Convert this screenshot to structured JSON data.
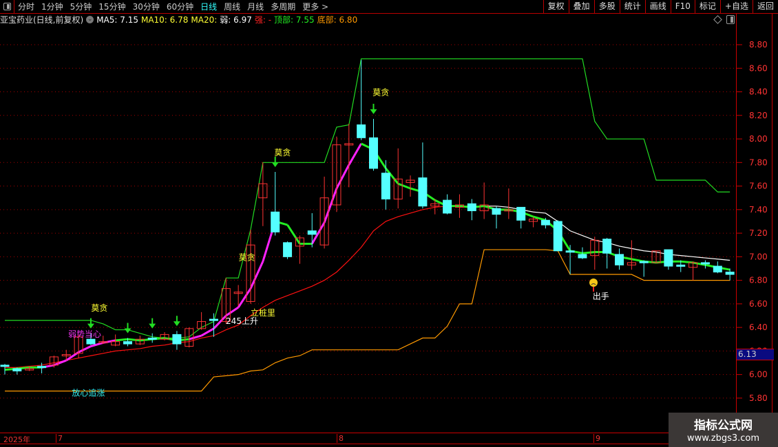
{
  "toolbar": {
    "tabs": [
      "分时",
      "1分钟",
      "5分钟",
      "15分钟",
      "30分钟",
      "60分钟",
      "日线",
      "周线",
      "月线",
      "多周期",
      "更多 >"
    ],
    "active_tab": "日线",
    "right_buttons": [
      "复权",
      "叠加",
      "多股",
      "统计",
      "画线",
      "F10",
      "标记",
      "+自选",
      "返回"
    ]
  },
  "info": {
    "title": "亚宝药业(日线,前复权)",
    "ma5": "MA5: 7.15",
    "ma10": "MA10: 6.78",
    "ma20": "MA20:",
    "weak": "弱: 6.97",
    "strong": "强: -",
    "top": "顶部: 7.55",
    "bottom": "底部: 6.80"
  },
  "price_tag": "6.13",
  "x_axis": {
    "year": "2025年",
    "months": [
      "7",
      "8",
      "9"
    ]
  },
  "watermark": {
    "line1": "指标公式网",
    "line2": "www.zbgs3.com"
  },
  "colors": {
    "up": "#ff3333",
    "down": "#54ffff",
    "top_line": "#22dd22",
    "bottom_line": "#ff9900",
    "ma20": "#ff1111",
    "weak_line": "#ffffff",
    "trend_up": "#ff22ff",
    "trend_flat": "#22ee22",
    "grid": "#aa0000",
    "axis_text": "#ff3333"
  },
  "chart_data": {
    "type": "candlestick",
    "title": "亚宝药业(日线,前复权)",
    "ylim": [
      5.7,
      8.95
    ],
    "y_ticks": [
      "8.80",
      "8.60",
      "8.40",
      "8.20",
      "8.00",
      "7.80",
      "7.60",
      "7.40",
      "7.20",
      "7.00",
      "6.80",
      "6.60",
      "6.40",
      "6.20",
      "6.00",
      "5.80"
    ],
    "candles": [
      [
        6.08,
        6.09,
        6.0,
        6.07
      ],
      [
        6.05,
        6.06,
        6.0,
        6.03
      ],
      [
        6.04,
        6.07,
        6.03,
        6.05
      ],
      [
        6.07,
        6.1,
        6.01,
        6.06
      ],
      [
        6.08,
        6.16,
        6.06,
        6.15
      ],
      [
        6.16,
        6.21,
        6.12,
        6.17
      ],
      [
        6.18,
        6.34,
        6.14,
        6.32
      ],
      [
        6.3,
        6.35,
        6.25,
        6.26
      ],
      [
        6.27,
        6.33,
        6.26,
        6.28
      ],
      [
        6.25,
        6.34,
        6.24,
        6.28
      ],
      [
        6.28,
        6.31,
        6.24,
        6.26
      ],
      [
        6.26,
        6.33,
        6.25,
        6.3
      ],
      [
        6.31,
        6.35,
        6.27,
        6.3
      ],
      [
        6.3,
        6.36,
        6.29,
        6.34
      ],
      [
        6.34,
        6.37,
        6.21,
        6.26
      ],
      [
        6.24,
        6.4,
        6.23,
        6.39
      ],
      [
        6.39,
        6.53,
        6.38,
        6.45
      ],
      [
        6.47,
        6.52,
        6.32,
        6.46
      ],
      [
        6.45,
        6.82,
        6.43,
        6.73
      ],
      [
        6.7,
        6.76,
        6.58,
        6.7
      ],
      [
        6.62,
        7.23,
        6.6,
        7.1
      ],
      [
        7.5,
        7.8,
        7.26,
        7.62
      ],
      [
        7.38,
        7.72,
        7.18,
        7.21
      ],
      [
        7.12,
        7.13,
        6.98,
        7.0
      ],
      [
        7.09,
        7.18,
        6.94,
        7.16
      ],
      [
        7.22,
        7.37,
        7.08,
        7.19
      ],
      [
        7.1,
        7.68,
        7.07,
        7.5
      ],
      [
        7.44,
        8.02,
        7.38,
        7.95
      ],
      [
        7.95,
        8.13,
        7.59,
        7.96
      ],
      [
        8.12,
        8.67,
        7.99,
        8.01
      ],
      [
        8.01,
        8.17,
        7.73,
        7.75
      ],
      [
        7.71,
        7.82,
        7.4,
        7.49
      ],
      [
        7.49,
        7.92,
        7.41,
        7.66
      ],
      [
        7.63,
        7.69,
        7.51,
        7.65
      ],
      [
        7.67,
        7.97,
        7.41,
        7.43
      ],
      [
        7.43,
        7.49,
        7.36,
        7.45
      ],
      [
        7.48,
        7.53,
        7.36,
        7.37
      ],
      [
        7.42,
        7.53,
        7.33,
        7.44
      ],
      [
        7.45,
        7.49,
        7.31,
        7.39
      ],
      [
        7.39,
        7.63,
        7.32,
        7.44
      ],
      [
        7.41,
        7.43,
        7.24,
        7.36
      ],
      [
        7.39,
        7.58,
        7.32,
        7.4
      ],
      [
        7.42,
        7.42,
        7.24,
        7.31
      ],
      [
        7.3,
        7.34,
        7.25,
        7.32
      ],
      [
        7.31,
        7.33,
        7.24,
        7.27
      ],
      [
        7.3,
        7.31,
        7.05,
        7.05
      ],
      [
        7.05,
        7.1,
        6.85,
        7.04
      ],
      [
        7.02,
        7.08,
        6.98,
        6.99
      ],
      [
        7.01,
        7.17,
        6.89,
        7.14
      ],
      [
        7.15,
        7.16,
        6.9,
        7.03
      ],
      [
        7.02,
        7.07,
        6.89,
        6.93
      ],
      [
        6.93,
        7.14,
        6.89,
        6.95
      ],
      [
        6.96,
        6.97,
        6.83,
        6.95
      ],
      [
        6.95,
        7.05,
        6.95,
        7.05
      ],
      [
        7.06,
        7.06,
        6.89,
        6.92
      ],
      [
        6.93,
        6.97,
        6.87,
        6.92
      ],
      [
        6.91,
        6.96,
        6.8,
        6.95
      ],
      [
        6.95,
        6.97,
        6.9,
        6.94
      ],
      [
        6.92,
        6.96,
        6.86,
        6.87
      ],
      [
        6.87,
        6.9,
        6.8,
        6.85
      ]
    ],
    "candle_fields": [
      "open",
      "high",
      "low",
      "close"
    ],
    "series": [
      {
        "name": "顶部",
        "values": [
          6.46,
          6.46,
          6.46,
          6.46,
          6.46,
          6.46,
          6.46,
          6.46,
          6.43,
          6.38,
          6.38,
          6.35,
          6.32,
          6.31,
          6.31,
          6.32,
          6.4,
          6.45,
          6.82,
          6.82,
          7.23,
          7.8,
          7.8,
          7.8,
          7.8,
          7.8,
          7.8,
          8.1,
          8.12,
          8.68,
          8.68,
          8.68,
          8.68,
          8.68,
          8.68,
          8.68,
          8.68,
          8.68,
          8.68,
          8.68,
          8.68,
          8.68,
          8.68,
          8.68,
          8.68,
          8.68,
          8.68,
          8.68,
          8.15,
          8.0,
          8.0,
          8.0,
          8.0,
          7.65,
          7.65,
          7.65,
          7.65,
          7.65,
          7.55,
          7.55
        ]
      },
      {
        "name": "底部",
        "values": [
          5.86,
          5.86,
          5.86,
          5.86,
          5.86,
          5.86,
          5.86,
          5.86,
          5.86,
          5.86,
          5.86,
          5.86,
          5.86,
          5.86,
          5.86,
          5.86,
          5.86,
          5.98,
          5.99,
          6.0,
          6.03,
          6.04,
          6.1,
          6.14,
          6.16,
          6.21,
          6.21,
          6.21,
          6.21,
          6.21,
          6.21,
          6.21,
          6.21,
          6.26,
          6.31,
          6.31,
          6.41,
          6.6,
          6.6,
          7.06,
          7.06,
          7.06,
          7.06,
          7.06,
          7.06,
          7.05,
          6.85,
          6.85,
          6.85,
          6.85,
          6.85,
          6.85,
          6.8,
          6.8,
          6.8,
          6.8,
          6.8,
          6.8,
          6.8,
          6.8
        ]
      },
      {
        "name": "MA20",
        "values": [
          6.06,
          6.06,
          6.07,
          6.08,
          6.1,
          6.12,
          6.14,
          6.16,
          6.18,
          6.2,
          6.21,
          6.22,
          6.24,
          6.25,
          6.27,
          6.28,
          6.31,
          6.33,
          6.38,
          6.42,
          6.5,
          6.57,
          6.63,
          6.67,
          6.71,
          6.75,
          6.8,
          6.87,
          6.97,
          7.08,
          7.22,
          7.3,
          7.34,
          7.37,
          7.4,
          7.42,
          7.43,
          7.43,
          7.43,
          7.43,
          7.43,
          null,
          null,
          null,
          null,
          null,
          null,
          null,
          null,
          null,
          null,
          null,
          null,
          null,
          null,
          null,
          null,
          null,
          null,
          null
        ]
      },
      {
        "name": "弱",
        "values": [
          null,
          null,
          null,
          null,
          null,
          null,
          null,
          null,
          null,
          null,
          null,
          null,
          null,
          null,
          null,
          null,
          null,
          null,
          null,
          null,
          null,
          null,
          null,
          null,
          null,
          null,
          null,
          null,
          null,
          null,
          null,
          null,
          null,
          null,
          null,
          null,
          null,
          null,
          null,
          7.43,
          7.43,
          7.42,
          7.4,
          7.38,
          7.37,
          7.3,
          7.22,
          7.18,
          7.14,
          7.12,
          7.09,
          7.07,
          7.05,
          7.04,
          7.02,
          7.01,
          7.0,
          6.99,
          6.98,
          6.97
        ]
      },
      {
        "name": "MA5",
        "values": [
          6.04,
          6.05,
          6.06,
          6.06,
          6.08,
          6.12,
          6.19,
          6.24,
          6.27,
          6.29,
          6.3,
          6.29,
          6.3,
          6.31,
          6.29,
          6.3,
          6.33,
          6.39,
          6.5,
          6.57,
          6.73,
          6.96,
          7.3,
          7.27,
          7.11,
          7.11,
          7.29,
          7.58,
          7.78,
          7.96,
          7.91,
          7.75,
          7.62,
          7.58,
          7.55,
          7.48,
          7.43,
          7.43,
          7.42,
          7.43,
          7.4,
          7.4,
          7.38,
          7.34,
          7.31,
          7.22,
          7.05,
          7.03,
          7.04,
          7.04,
          7.0,
          6.98,
          6.96,
          6.95,
          6.96,
          6.96,
          6.95,
          6.93,
          6.91,
          6.89
        ]
      }
    ],
    "buy_arrows": [
      7,
      10,
      12,
      14,
      22,
      30
    ],
    "annotations": [
      {
        "text": "莫贪",
        "index": 7.7,
        "price": 6.54,
        "color": "#ffff33"
      },
      {
        "text": "莫贪",
        "index": 22.6,
        "price": 7.86,
        "color": "#ffff33"
      },
      {
        "text": "莫贪",
        "index": 19.7,
        "price": 6.97,
        "color": "#ffff33"
      },
      {
        "text": "莫贪",
        "index": 30.6,
        "price": 8.37,
        "color": "#ffff33"
      },
      {
        "text": "弱势当心",
        "index": 6.5,
        "price": 6.32,
        "color": "#ee33ee"
      },
      {
        "text": "放心追涨",
        "index": 6.8,
        "price": 5.82,
        "color": "#33eeee"
      },
      {
        "text": "245上升",
        "index": 19.3,
        "price": 6.43,
        "color": "#ffffff"
      },
      {
        "text": "立桩里",
        "index": 21.0,
        "price": 6.5,
        "color": "#ffff33"
      },
      {
        "text": "出手",
        "index": 48.5,
        "price": 6.64,
        "color": "#ffffff"
      }
    ],
    "sad_face": {
      "index": 47.9,
      "price": 6.78
    }
  }
}
